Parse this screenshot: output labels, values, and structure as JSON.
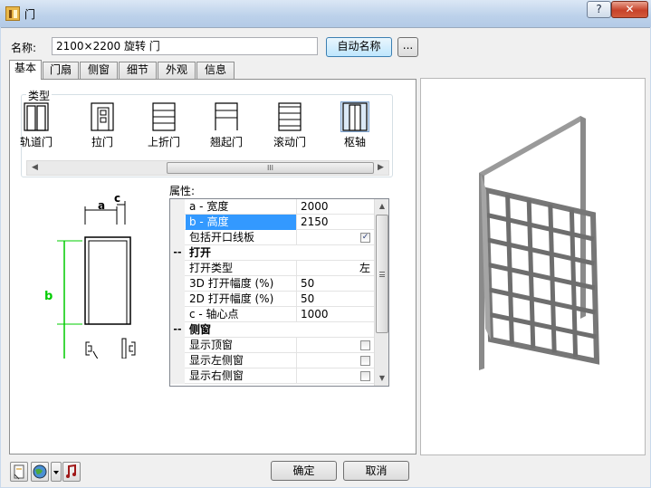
{
  "window": {
    "title": "门",
    "help_label": "?",
    "close_label": "✕"
  },
  "name_field": {
    "label": "名称:",
    "value": "2100×2200 旋转 门",
    "auto_name_button": "自动名称",
    "browse_button": "..."
  },
  "tabs": [
    {
      "label": "基本",
      "active": true
    },
    {
      "label": "门扇"
    },
    {
      "label": "侧窗"
    },
    {
      "label": "细节"
    },
    {
      "label": "外观"
    },
    {
      "label": "信息"
    }
  ],
  "type_group": {
    "label": "类型",
    "items": [
      {
        "label": "轨道门",
        "icon": "sliding-door-icon"
      },
      {
        "label": "拉门",
        "icon": "pull-door-icon"
      },
      {
        "label": "上折门",
        "icon": "folding-door-icon"
      },
      {
        "label": "翘起门",
        "icon": "tilt-door-icon"
      },
      {
        "label": "滚动门",
        "icon": "rolling-door-icon"
      },
      {
        "label": "枢轴",
        "icon": "pivot-door-icon",
        "selected": true
      }
    ],
    "scroll_grip": "III"
  },
  "diagram": {
    "label_a": "a",
    "label_b": "b",
    "label_c": "c"
  },
  "properties": {
    "label": "属性:",
    "rows": [
      {
        "name": "a - 宽度",
        "value": "2000"
      },
      {
        "name": "b - 高度",
        "value": "2150",
        "selected": true
      },
      {
        "name": "包括开口线板",
        "value": "",
        "checkbox": true,
        "checked": true
      },
      {
        "name": "打开",
        "category": true,
        "gutter": "--"
      },
      {
        "name": "打开类型",
        "value": "左",
        "align": "right"
      },
      {
        "name": "3D 打开幅度 (%)",
        "value": "50"
      },
      {
        "name": "2D 打开幅度 (%)",
        "value": "50"
      },
      {
        "name": "c - 轴心点",
        "value": "1000"
      },
      {
        "name": "侧窗",
        "category": true,
        "gutter": "--"
      },
      {
        "name": "显示顶窗",
        "value": "",
        "checkbox": true,
        "checked": false
      },
      {
        "name": "显示左侧窗",
        "value": "",
        "checkbox": true,
        "checked": false
      },
      {
        "name": "显示右侧窗",
        "value": "",
        "checkbox": true,
        "checked": false
      }
    ]
  },
  "buttons": {
    "ok": "确定",
    "cancel": "取消"
  },
  "colors": {
    "accent_green": "#00cc00",
    "selection_blue": "#3399ff",
    "frame_gray": "#7a7a7a"
  }
}
